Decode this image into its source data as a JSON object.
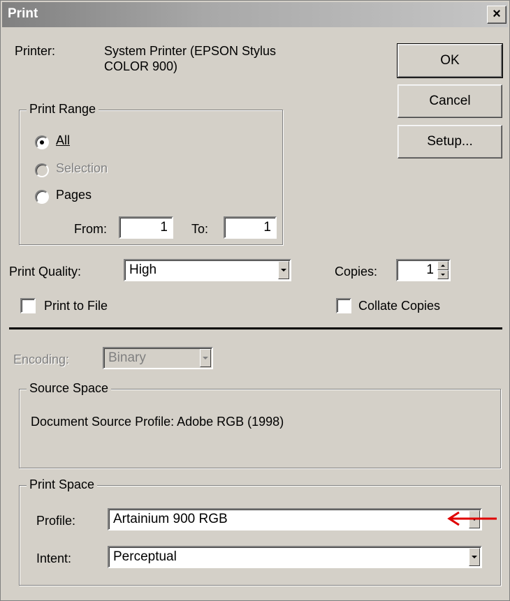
{
  "window": {
    "title": "Print",
    "close_symbol": "×"
  },
  "printer": {
    "label": "Printer:",
    "name_line1": "System Printer (EPSON Stylus",
    "name_line2": "COLOR 900)"
  },
  "buttons": {
    "ok": "OK",
    "cancel": "Cancel",
    "setup": "Setup..."
  },
  "print_range": {
    "title": "Print Range",
    "options": [
      {
        "label": "All",
        "selected": true,
        "disabled": false
      },
      {
        "label": "Selection",
        "selected": false,
        "disabled": true
      },
      {
        "label": "Pages",
        "selected": false,
        "disabled": false
      }
    ],
    "from_label": "From:",
    "from_value": "1",
    "to_label": "To:",
    "to_value": "1"
  },
  "print_quality": {
    "label": "Print Quality:",
    "value": "High"
  },
  "copies": {
    "label": "Copies:",
    "value": "1"
  },
  "print_to_file": {
    "label": "Print to File",
    "checked": false
  },
  "collate": {
    "label": "Collate Copies",
    "checked": false
  },
  "encoding": {
    "label": "Encoding:",
    "value": "Binary",
    "disabled": true
  },
  "source_space": {
    "title": "Source Space",
    "text": "Document Source Profile: Adobe RGB (1998)"
  },
  "print_space": {
    "title": "Print Space",
    "profile_label": "Profile:",
    "profile_value": "Artainium 900 RGB",
    "intent_label": "Intent:",
    "intent_value": "Perceptual"
  },
  "annotation": {
    "arrow_color": "#e00000"
  },
  "colors": {
    "dialog_bg": "#d4d0c8",
    "titlebar": "#808080"
  }
}
